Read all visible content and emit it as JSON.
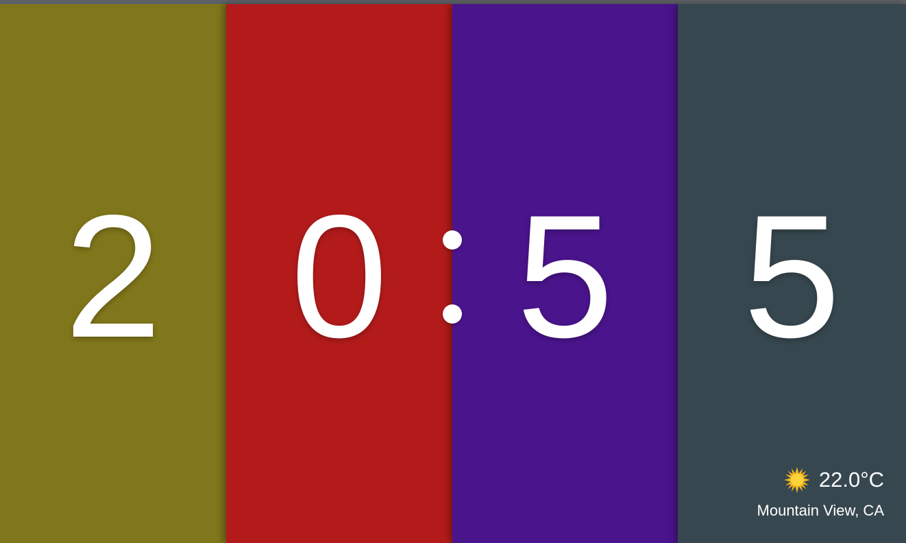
{
  "clock": {
    "digits": [
      "2",
      "0",
      "5",
      "5"
    ],
    "colors": {
      "panel1": "#80761b",
      "panel2": "#b31b1b",
      "panel3": "#4a148c",
      "panel4": "#37474f"
    }
  },
  "weather": {
    "icon": "sun-icon",
    "temperature": "22.0°C",
    "location": "Mountain View, CA"
  }
}
